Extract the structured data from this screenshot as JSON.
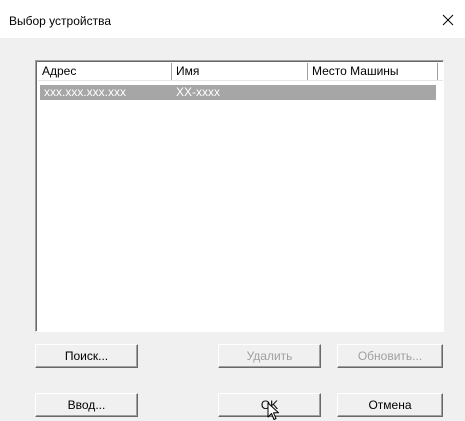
{
  "window": {
    "title": "Выбор устройства"
  },
  "device_list": {
    "columns": [
      "Адрес",
      "Имя",
      "Место Машины"
    ],
    "rows": [
      {
        "address": "xxx.xxx.xxx.xxx",
        "name": "XX-xxxx",
        "location": "",
        "selected": true
      }
    ]
  },
  "buttons": {
    "search": "Поиск...",
    "delete": "Удалить",
    "update": "Обновить...",
    "enter": "Ввод...",
    "ok": "OK",
    "cancel": "Отмена"
  },
  "colors": {
    "selection": "#a6a6a6",
    "disabled_text": "#a0a0a0",
    "face": "#f0f0f0"
  }
}
